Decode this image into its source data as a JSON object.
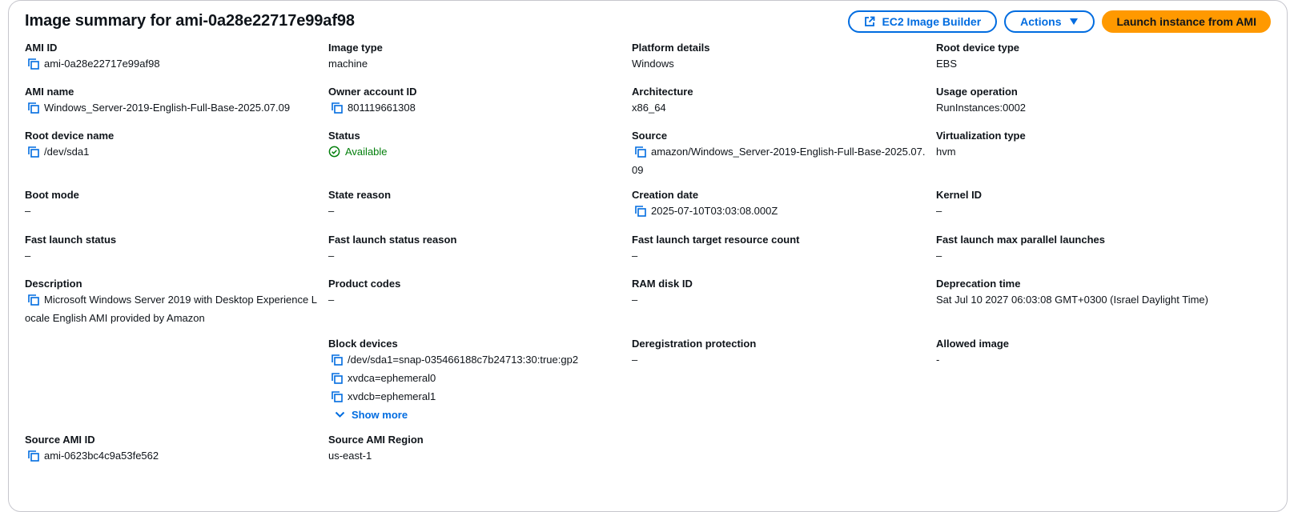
{
  "header": {
    "title": "Image summary for ami-0a28e22717e99af98",
    "image_builder_label": "EC2 Image Builder",
    "actions_label": "Actions",
    "launch_label": "Launch instance from AMI"
  },
  "fields": {
    "ami_id": {
      "label": "AMI ID",
      "value": "ami-0a28e22717e99af98"
    },
    "image_type": {
      "label": "Image type",
      "value": "machine"
    },
    "platform_details": {
      "label": "Platform details",
      "value": "Windows"
    },
    "root_device_type": {
      "label": "Root device type",
      "value": "EBS"
    },
    "ami_name": {
      "label": "AMI name",
      "value": "Windows_Server-2019-English-Full-Base-2025.07.09"
    },
    "owner_account_id": {
      "label": "Owner account ID",
      "value": "801119661308"
    },
    "architecture": {
      "label": "Architecture",
      "value": "x86_64"
    },
    "usage_operation": {
      "label": "Usage operation",
      "value": "RunInstances:0002"
    },
    "root_device_name": {
      "label": "Root device name",
      "value": "/dev/sda1"
    },
    "status": {
      "label": "Status",
      "value": "Available"
    },
    "source": {
      "label": "Source",
      "value": "amazon/Windows_Server-2019-English-Full-Base-2025.07.09"
    },
    "virtualization_type": {
      "label": "Virtualization type",
      "value": "hvm"
    },
    "boot_mode": {
      "label": "Boot mode",
      "value": "–"
    },
    "state_reason": {
      "label": "State reason",
      "value": "–"
    },
    "creation_date": {
      "label": "Creation date",
      "value": "2025-07-10T03:03:08.000Z"
    },
    "kernel_id": {
      "label": "Kernel ID",
      "value": "–"
    },
    "fast_launch_status": {
      "label": "Fast launch status",
      "value": "–"
    },
    "fast_launch_status_reason": {
      "label": "Fast launch status reason",
      "value": "–"
    },
    "fast_launch_target": {
      "label": "Fast launch target resource count",
      "value": "–"
    },
    "fast_launch_max": {
      "label": "Fast launch max parallel launches",
      "value": "–"
    },
    "description": {
      "label": "Description",
      "value": "Microsoft Windows Server 2019 with Desktop Experience Locale English AMI provided by Amazon"
    },
    "product_codes": {
      "label": "Product codes",
      "value": "–"
    },
    "ram_disk_id": {
      "label": "RAM disk ID",
      "value": "–"
    },
    "deprecation_time": {
      "label": "Deprecation time",
      "value": "Sat Jul 10 2027 06:03:08 GMT+0300 (Israel Daylight Time)"
    },
    "block_devices": {
      "label": "Block devices",
      "items": [
        "/dev/sda1=snap-035466188c7b24713:30:true:gp2",
        "xvdca=ephemeral0",
        "xvdcb=ephemeral1"
      ],
      "show_more_label": "Show more"
    },
    "deregistration_protection": {
      "label": "Deregistration protection",
      "value": "–"
    },
    "allowed_image": {
      "label": "Allowed image",
      "value": "-"
    },
    "source_ami_id": {
      "label": "Source AMI ID",
      "value": "ami-0623bc4c9a53fe562"
    },
    "source_ami_region": {
      "label": "Source AMI Region",
      "value": "us-east-1"
    }
  },
  "colors": {
    "link": "#006ce0",
    "primary": "#ff9900",
    "success": "#037f0c",
    "text": "#0f141a",
    "border": "#c6c6cd"
  }
}
